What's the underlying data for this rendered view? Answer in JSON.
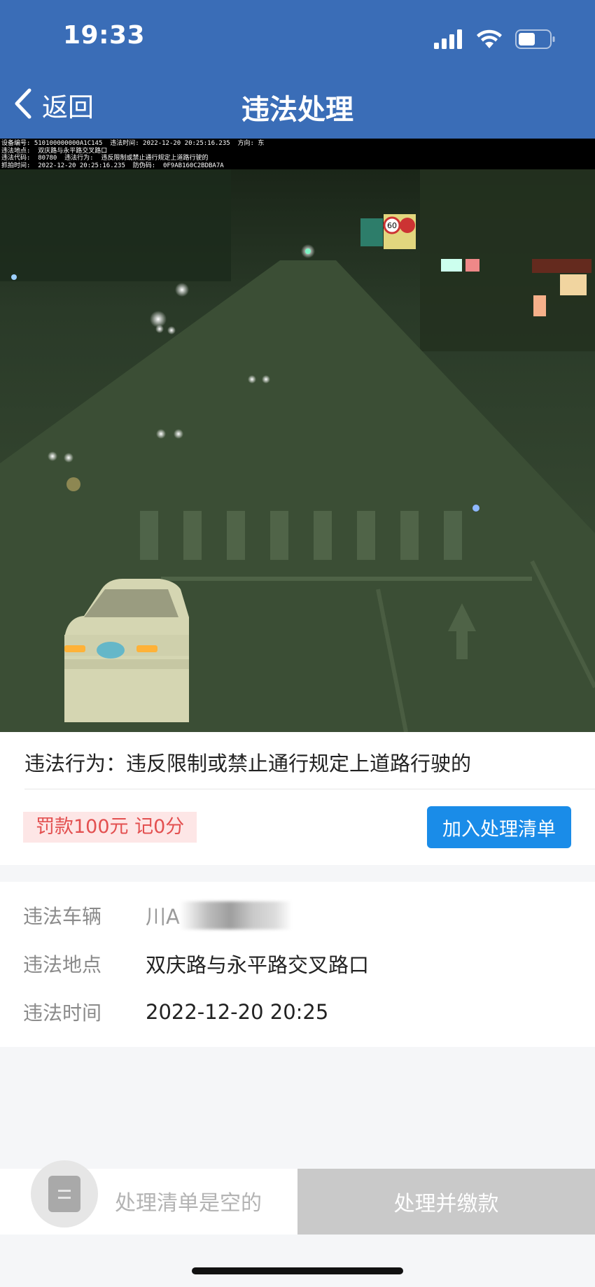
{
  "status_bar": {
    "time": "19:33"
  },
  "nav": {
    "back_label": "返回",
    "title": "违法处理"
  },
  "evidence": {
    "caption_lines": [
      "设备编号: 510100000000A1C145  违法时间: 2022-12-20 20:25:16.235  方向: 东",
      "违法地点:  双庆路与永平路交叉路口",
      "违法代码:  80780  违法行为:  违反限制或禁止通行规定上道路行驶的",
      "抓拍时间:  2022-12-20 20:25:16.235  防伪码:  0F9AB160C2BDBA7A"
    ],
    "speed_sign": "60"
  },
  "violation": {
    "behavior_label": "违法行为：",
    "behavior_value": "违反限制或禁止通行规定上道路行驶的",
    "fine_text": "罚款100元  记0分",
    "add_button": "加入处理清单"
  },
  "details": {
    "vehicle_label": "违法车辆",
    "vehicle_value": "川A",
    "location_label": "违法地点",
    "location_value": "双庆路与永平路交叉路口",
    "time_label": "违法时间",
    "time_value": "2022-12-20 20:25"
  },
  "bottom": {
    "empty_text": "处理清单是空的",
    "pay_button": "处理并缴款"
  }
}
